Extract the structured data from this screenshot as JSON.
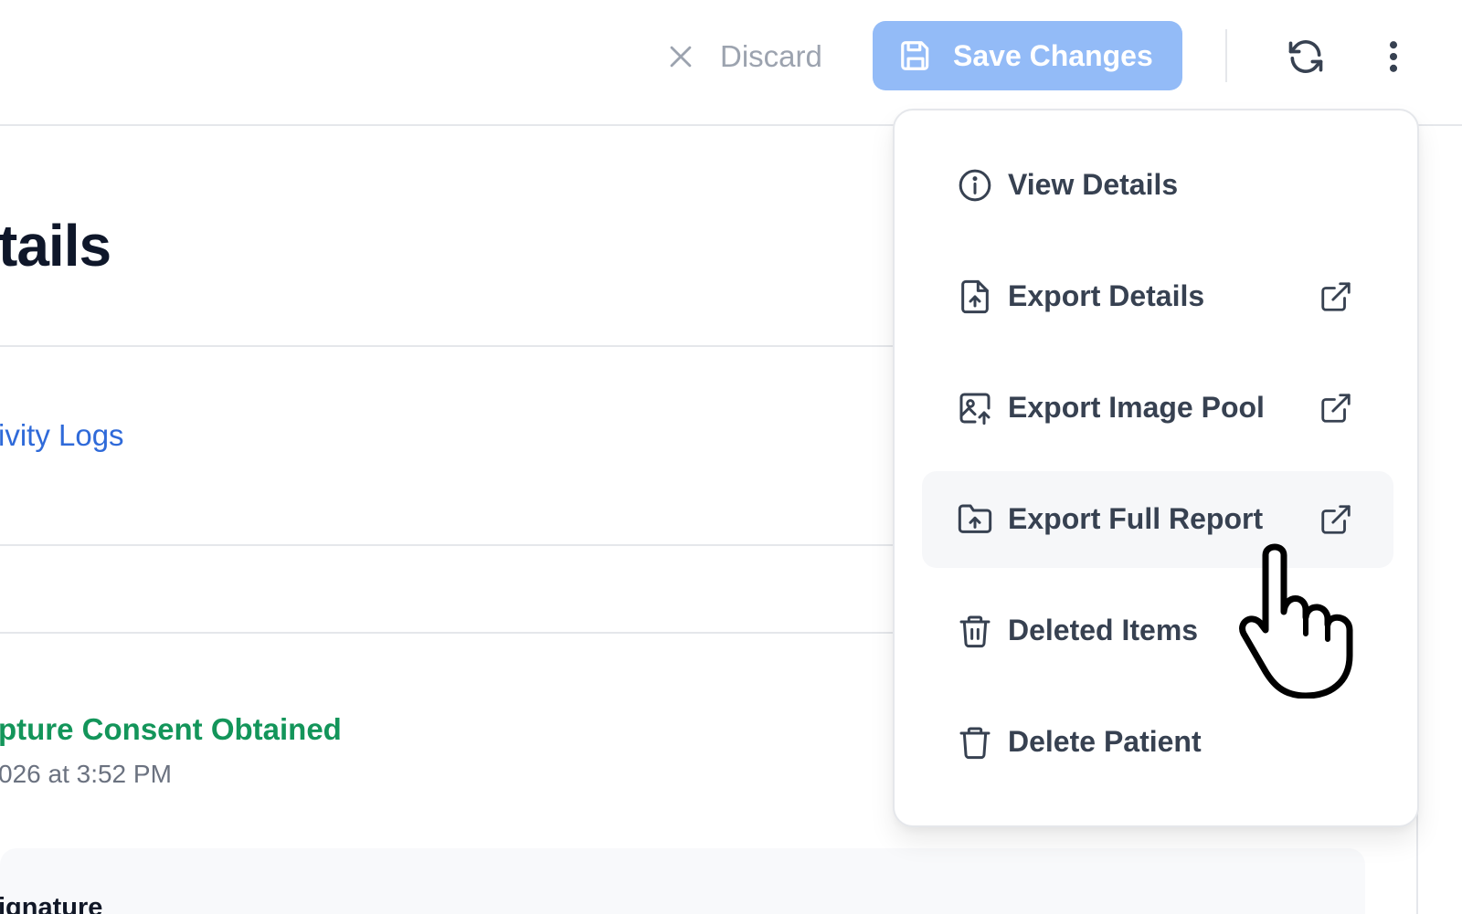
{
  "toolbar": {
    "discard_label": "Discard",
    "save_label": "Save Changes",
    "save_color": "#93bbf7"
  },
  "page": {
    "title_partial": "tails",
    "activity_logs_link": "ivity Logs",
    "consent_status": "pture Consent Obtained",
    "consent_timestamp": "026 at 3:52 PM",
    "signature_label": "ignature"
  },
  "menu": {
    "items": [
      {
        "label": "View Details",
        "icon": "info-icon",
        "external": false
      },
      {
        "label": "Export Details",
        "icon": "file-upload-icon",
        "external": true
      },
      {
        "label": "Export Image Pool",
        "icon": "image-upload-icon",
        "external": true
      },
      {
        "label": "Export Full Report",
        "icon": "folder-upload-icon",
        "external": true,
        "hovered": true
      },
      {
        "label": "Deleted Items",
        "icon": "trash-lines-icon",
        "external": false
      },
      {
        "label": "Delete Patient",
        "icon": "trash-icon",
        "external": false
      }
    ]
  },
  "colors": {
    "link": "#2f6ad9",
    "consent_green": "#13955a",
    "text_muted": "#6b7280"
  }
}
